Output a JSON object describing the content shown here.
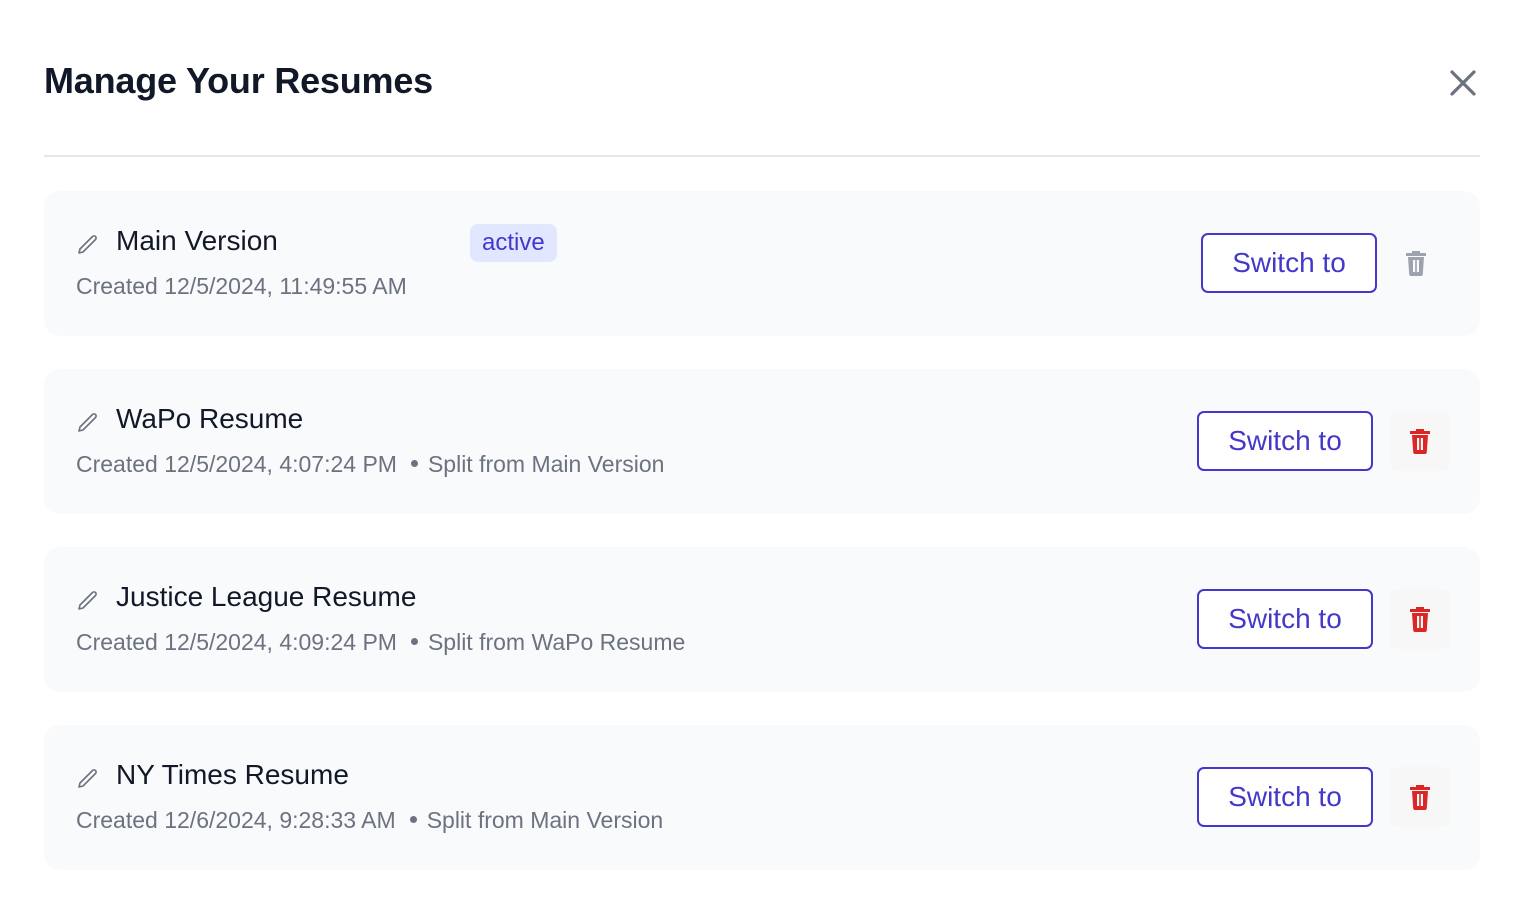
{
  "dialog": {
    "title": "Manage Your Resumes",
    "close_icon": "close-icon"
  },
  "colors": {
    "accent": "#4338ca",
    "badge_bg": "#e0e7ff",
    "danger": "#dc2626",
    "disabled_icon": "#9ca3af",
    "muted_text": "#6b7280",
    "card_bg": "#f9fafb"
  },
  "resumes": [
    {
      "name": "Main Version",
      "badge": "active",
      "created": "Created 12/5/2024, 11:49:55 AM",
      "split_from": "",
      "switch_label": "Switch to",
      "edit_icon": "pencil-icon",
      "delete_icon": "trash-icon",
      "delete_enabled": false
    },
    {
      "name": "WaPo Resume",
      "badge": "",
      "created": "Created 12/5/2024, 4:07:24 PM",
      "split_from": "Split from Main Version",
      "switch_label": "Switch to",
      "edit_icon": "pencil-icon",
      "delete_icon": "trash-icon",
      "delete_enabled": true
    },
    {
      "name": "Justice League Resume",
      "badge": "",
      "created": "Created 12/5/2024, 4:09:24 PM",
      "split_from": "Split from WaPo Resume",
      "switch_label": "Switch to",
      "edit_icon": "pencil-icon",
      "delete_icon": "trash-icon",
      "delete_enabled": true
    },
    {
      "name": "NY Times Resume",
      "badge": "",
      "created": "Created 12/6/2024, 9:28:33 AM",
      "split_from": "Split from Main Version",
      "switch_label": "Switch to",
      "edit_icon": "pencil-icon",
      "delete_icon": "trash-icon",
      "delete_enabled": true
    }
  ]
}
